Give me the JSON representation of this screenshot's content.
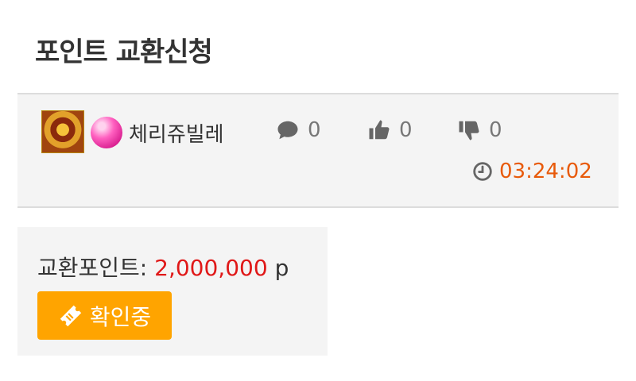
{
  "page": {
    "title": "포인트 교환신청"
  },
  "post": {
    "username": "체리쥬빌레",
    "comments": "0",
    "likes": "0",
    "dislikes": "0",
    "time": "03:24:02"
  },
  "exchange": {
    "label": "교환포인트:",
    "amount": "2,000,000",
    "unit": "p",
    "status_label": "확인중"
  },
  "colors": {
    "accent": "#ffa400",
    "amount": "#e01818",
    "time": "#e85a0a",
    "panel": "#f4f4f4"
  },
  "icons": [
    "comment-icon",
    "thumbs-up-icon",
    "thumbs-down-icon",
    "clock-icon",
    "ticket-icon"
  ]
}
